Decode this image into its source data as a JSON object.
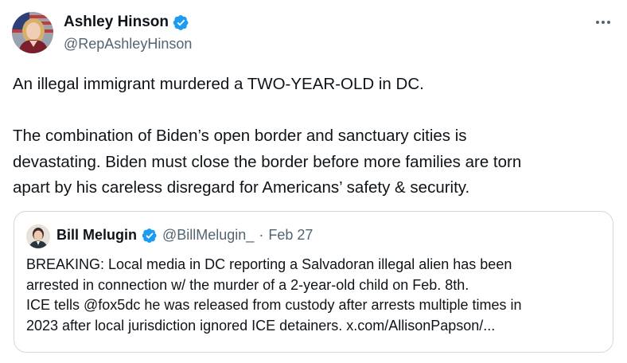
{
  "author": {
    "name": "Ashley Hinson",
    "handle": "@RepAshleyHinson"
  },
  "tweet": {
    "lines": [
      "An illegal immigrant murdered a TWO-YEAR-OLD in DC.",
      "The combination of Biden’s open border and sanctuary cities is",
      "devastating. Biden must close the border before more families are torn",
      "apart by his careless disregard for Americans’ safety & security."
    ]
  },
  "quote": {
    "name": "Bill Melugin",
    "handle": "@BillMelugin_",
    "separator": "·",
    "date": "Feb 27",
    "lines": [
      "BREAKING: Local media in DC reporting a Salvadoran illegal alien has been",
      "arrested in connection w/ the murder of a 2-year-old child on Feb. 8th.",
      "ICE tells @fox5dc he was released from custody after arrests multiple times in",
      "2023 after local jurisdiction ignored ICE detainers. x.com/AllisonPapson/..."
    ]
  },
  "icons": {
    "verified": "verified-badge-icon",
    "more": "more-options-icon"
  },
  "colors": {
    "verified": "#1d9bf0",
    "text": "#0f1419",
    "secondary": "#536471",
    "border": "#cfd9de"
  }
}
